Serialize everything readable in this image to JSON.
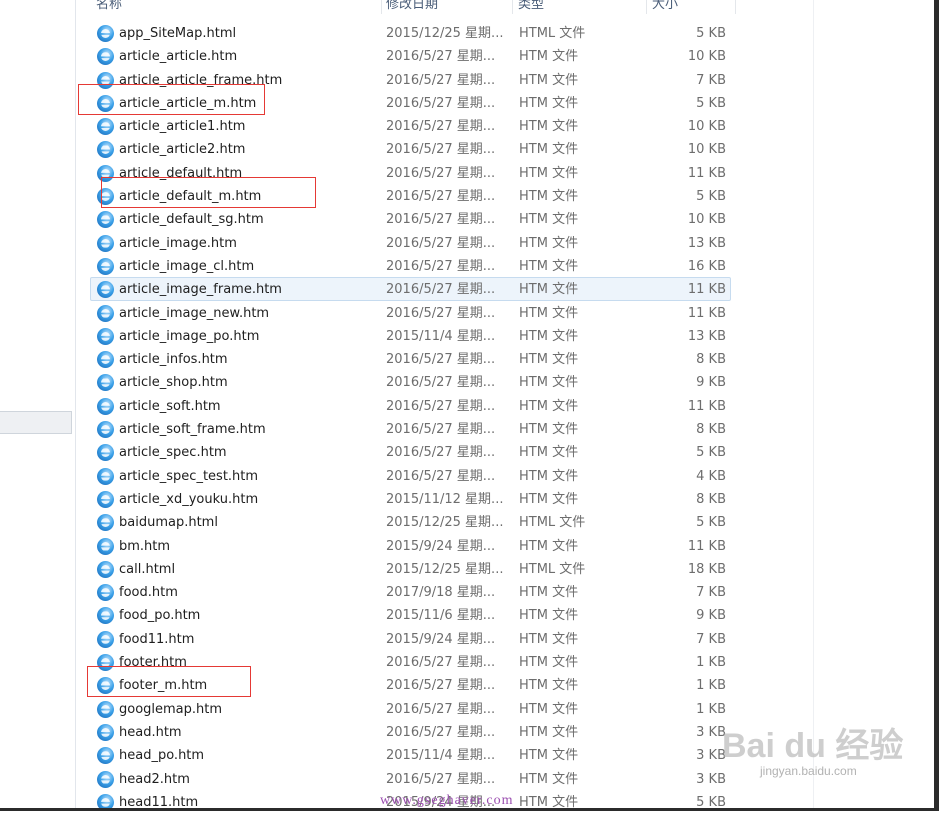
{
  "headers": {
    "name": "名称",
    "date": "修改日期",
    "type": "类型",
    "size": "大小"
  },
  "files": [
    {
      "name": "app_SiteMap.html",
      "date": "2015/12/25 星期...",
      "type": "HTML 文件",
      "size": "5 KB"
    },
    {
      "name": "article_article.htm",
      "date": "2016/5/27 星期...",
      "type": "HTM 文件",
      "size": "10 KB"
    },
    {
      "name": "article_article_frame.htm",
      "date": "2016/5/27 星期...",
      "type": "HTM 文件",
      "size": "7 KB"
    },
    {
      "name": "article_article_m.htm",
      "date": "2016/5/27 星期...",
      "type": "HTM 文件",
      "size": "5 KB",
      "highlighted": true
    },
    {
      "name": "article_article1.htm",
      "date": "2016/5/27 星期...",
      "type": "HTM 文件",
      "size": "10 KB"
    },
    {
      "name": "article_article2.htm",
      "date": "2016/5/27 星期...",
      "type": "HTM 文件",
      "size": "10 KB"
    },
    {
      "name": "article_default.htm",
      "date": "2016/5/27 星期...",
      "type": "HTM 文件",
      "size": "11 KB"
    },
    {
      "name": "article_default_m.htm",
      "date": "2016/5/27 星期...",
      "type": "HTM 文件",
      "size": "5 KB",
      "highlighted": true
    },
    {
      "name": "article_default_sg.htm",
      "date": "2016/5/27 星期...",
      "type": "HTM 文件",
      "size": "10 KB"
    },
    {
      "name": "article_image.htm",
      "date": "2016/5/27 星期...",
      "type": "HTM 文件",
      "size": "13 KB"
    },
    {
      "name": "article_image_cl.htm",
      "date": "2016/5/27 星期...",
      "type": "HTM 文件",
      "size": "16 KB"
    },
    {
      "name": "article_image_frame.htm",
      "date": "2016/5/27 星期...",
      "type": "HTM 文件",
      "size": "11 KB",
      "selected": true
    },
    {
      "name": "article_image_new.htm",
      "date": "2016/5/27 星期...",
      "type": "HTM 文件",
      "size": "11 KB"
    },
    {
      "name": "article_image_po.htm",
      "date": "2015/11/4 星期...",
      "type": "HTM 文件",
      "size": "13 KB"
    },
    {
      "name": "article_infos.htm",
      "date": "2016/5/27 星期...",
      "type": "HTM 文件",
      "size": "8 KB"
    },
    {
      "name": "article_shop.htm",
      "date": "2016/5/27 星期...",
      "type": "HTM 文件",
      "size": "9 KB"
    },
    {
      "name": "article_soft.htm",
      "date": "2016/5/27 星期...",
      "type": "HTM 文件",
      "size": "11 KB"
    },
    {
      "name": "article_soft_frame.htm",
      "date": "2016/5/27 星期...",
      "type": "HTM 文件",
      "size": "8 KB"
    },
    {
      "name": "article_spec.htm",
      "date": "2016/5/27 星期...",
      "type": "HTM 文件",
      "size": "5 KB"
    },
    {
      "name": "article_spec_test.htm",
      "date": "2016/5/27 星期...",
      "type": "HTM 文件",
      "size": "4 KB"
    },
    {
      "name": "article_xd_youku.htm",
      "date": "2015/11/12 星期...",
      "type": "HTM 文件",
      "size": "8 KB"
    },
    {
      "name": "baidumap.html",
      "date": "2015/12/25 星期...",
      "type": "HTML 文件",
      "size": "5 KB"
    },
    {
      "name": "bm.htm",
      "date": "2015/9/24 星期...",
      "type": "HTM 文件",
      "size": "11 KB"
    },
    {
      "name": "call.html",
      "date": "2015/12/25 星期...",
      "type": "HTML 文件",
      "size": "18 KB"
    },
    {
      "name": "food.htm",
      "date": "2017/9/18 星期...",
      "type": "HTM 文件",
      "size": "7 KB"
    },
    {
      "name": "food_po.htm",
      "date": "2015/11/6 星期...",
      "type": "HTM 文件",
      "size": "9 KB"
    },
    {
      "name": "food11.htm",
      "date": "2015/9/24 星期...",
      "type": "HTM 文件",
      "size": "7 KB"
    },
    {
      "name": "footer.htm",
      "date": "2016/5/27 星期...",
      "type": "HTM 文件",
      "size": "1 KB"
    },
    {
      "name": "footer_m.htm",
      "date": "2016/5/27 星期...",
      "type": "HTM 文件",
      "size": "1 KB",
      "highlighted": true
    },
    {
      "name": "googlemap.htm",
      "date": "2016/5/27 星期...",
      "type": "HTM 文件",
      "size": "1 KB"
    },
    {
      "name": "head.htm",
      "date": "2016/5/27 星期...",
      "type": "HTM 文件",
      "size": "3 KB"
    },
    {
      "name": "head_po.htm",
      "date": "2015/11/4 星期...",
      "type": "HTM 文件",
      "size": "3 KB"
    },
    {
      "name": "head2.htm",
      "date": "2016/5/27 星期...",
      "type": "HTM 文件",
      "size": "3 KB"
    },
    {
      "name": "head11.htm",
      "date": "2015/9/24 星期...",
      "type": "HTM 文件",
      "size": "5 KB"
    }
  ],
  "icon": "ie-html-file-icon",
  "colors": {
    "highlight_border": "#e53935",
    "selection_bg": "#edf4fb",
    "selection_border": "#c6dbef"
  },
  "watermark": {
    "logo": "Bai du 经验",
    "url": "jingyan.baidu.com",
    "bottom": "www.gseghaver.com"
  }
}
